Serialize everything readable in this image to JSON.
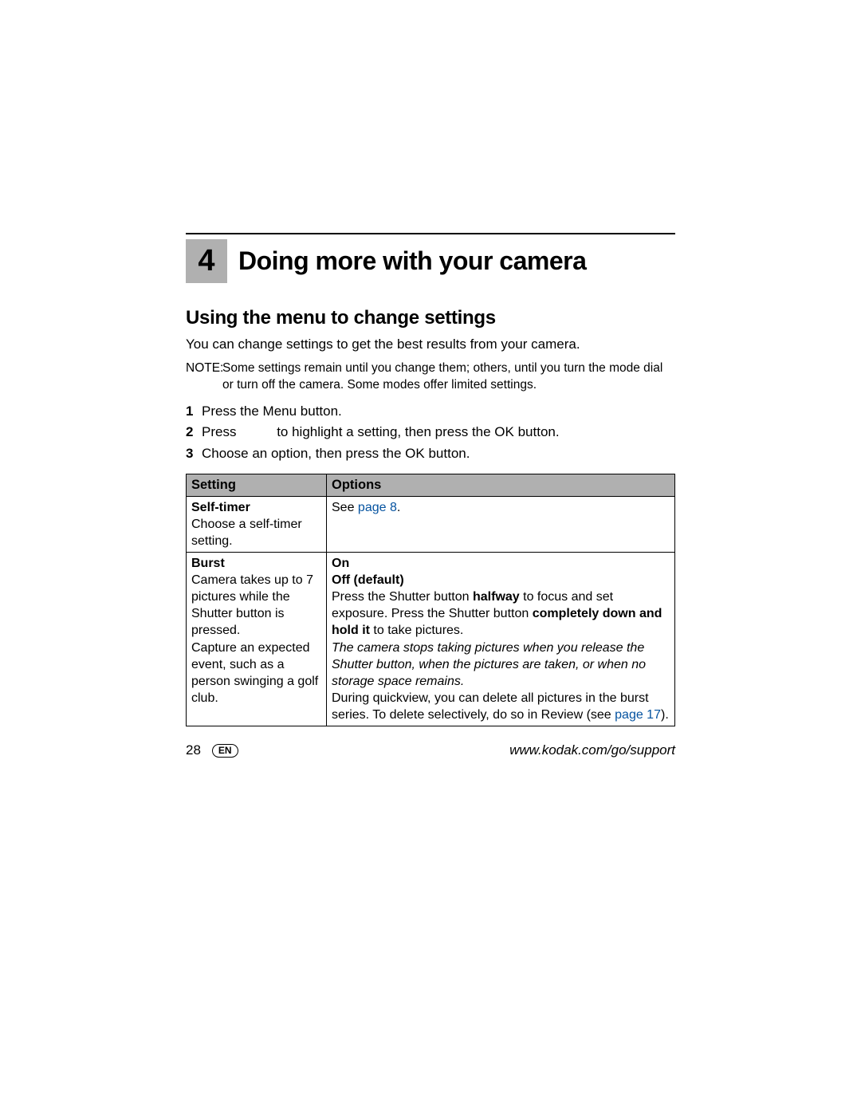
{
  "chapter": {
    "number": "4",
    "title": "Doing more with your camera"
  },
  "section": {
    "title": "Using the menu to change settings"
  },
  "intro": "You can change settings to get the best results from your camera.",
  "note": {
    "label": "NOTE:",
    "text": "Some settings remain until you change them; others, until you turn the mode dial or turn off the camera. Some modes offer limited settings."
  },
  "steps": [
    {
      "n": "1",
      "text": "Press the Menu button."
    },
    {
      "n": "2",
      "pre": "Press ",
      "post": "to highlight a setting, then press the OK button."
    },
    {
      "n": "3",
      "text": "Choose an option, then press the OK button."
    }
  ],
  "table": {
    "headers": {
      "c1": "Setting",
      "c2": "Options"
    },
    "row1": {
      "name": "Self-timer",
      "desc": "Choose a self-timer setting.",
      "opt_pre": "See ",
      "opt_link": "page 8",
      "opt_post": "."
    },
    "row2": {
      "name": "Burst",
      "desc1": "Camera takes up to 7 pictures while the Shutter button is pressed.",
      "desc2": "Capture an expected event, such as a person swinging a golf club.",
      "on": "On",
      "off": "Off (default)",
      "p1a": "Press the Shutter button ",
      "p1b": "halfway",
      "p1c": " to focus and set exposure. Press the Shutter button ",
      "p1d": "completely down and hold it",
      "p1e": " to take pictures.",
      "p2": "The camera stops taking pictures when you release the Shutter button, when the pictures are taken, or when no storage space remains.",
      "p3a": "During quickview, you can delete all pictures in the burst series. To delete selectively, do so in Review (see ",
      "p3b": "page 17",
      "p3c": ")."
    }
  },
  "footer": {
    "page": "28",
    "lang": "EN",
    "url": "www.kodak.com/go/support"
  }
}
